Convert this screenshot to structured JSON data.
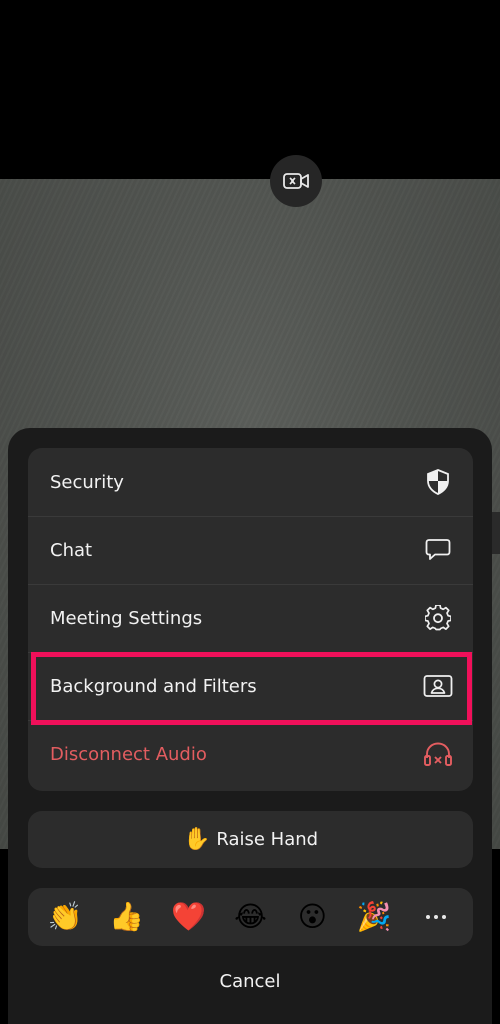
{
  "camera": {
    "switch_icon": "camera-switch-icon"
  },
  "menu": {
    "items": [
      {
        "label": "Security",
        "icon": "shield-icon"
      },
      {
        "label": "Chat",
        "icon": "chat-bubble-icon"
      },
      {
        "label": "Meeting Settings",
        "icon": "gear-icon"
      },
      {
        "label": "Background and Filters",
        "icon": "background-person-icon",
        "highlighted": true
      },
      {
        "label": "Disconnect Audio",
        "icon": "headphones-off-icon",
        "color": "#e35d60"
      }
    ]
  },
  "raise_hand": {
    "emoji": "✋",
    "label": "Raise Hand"
  },
  "reactions": {
    "items": [
      {
        "name": "clapping-hands",
        "emoji": "👏"
      },
      {
        "name": "thumbs-up",
        "emoji": "👍"
      },
      {
        "name": "red-heart",
        "emoji": "❤️"
      },
      {
        "name": "tears-of-joy",
        "emoji": "😂"
      },
      {
        "name": "surprised-face",
        "emoji": "😮"
      },
      {
        "name": "party-popper",
        "emoji": "🎉"
      }
    ],
    "more_icon": "more-horizontal-icon"
  },
  "cancel_label": "Cancel",
  "colors": {
    "highlight": "#f0105a",
    "danger": "#e35d60",
    "sheet_bg": "#1b1b1b",
    "group_bg": "#2c2c2c"
  }
}
